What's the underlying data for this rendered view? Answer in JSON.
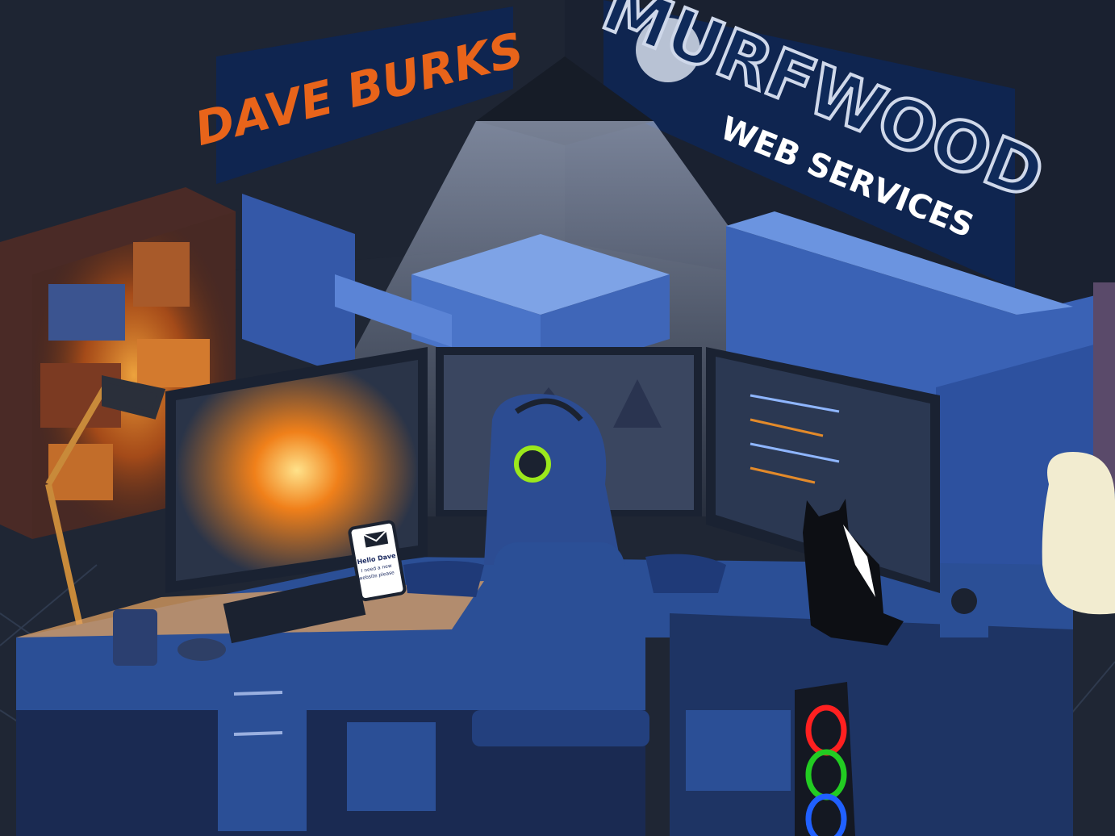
{
  "signs": {
    "left_name": "DAVE BURKS",
    "logo_word": "MURFWOOD",
    "logo_tagline": "WEB SERVICES"
  },
  "phone": {
    "message_line1": "Hello Dave",
    "message_line2": "I need a new",
    "message_line3": "website please"
  },
  "colors": {
    "background": "#1b2230",
    "sign_panel": "#0f2550",
    "dave_text": "#e8641a",
    "logo_navy": "#0f2a5a",
    "desk_blue": "#2b4f96",
    "lamp_glow": "#f08a2a",
    "headphone_green": "#9be81c"
  },
  "icons": {
    "envelope": "envelope-icon",
    "pc_rings": [
      "red-ring",
      "green-ring",
      "blue-ring"
    ]
  }
}
